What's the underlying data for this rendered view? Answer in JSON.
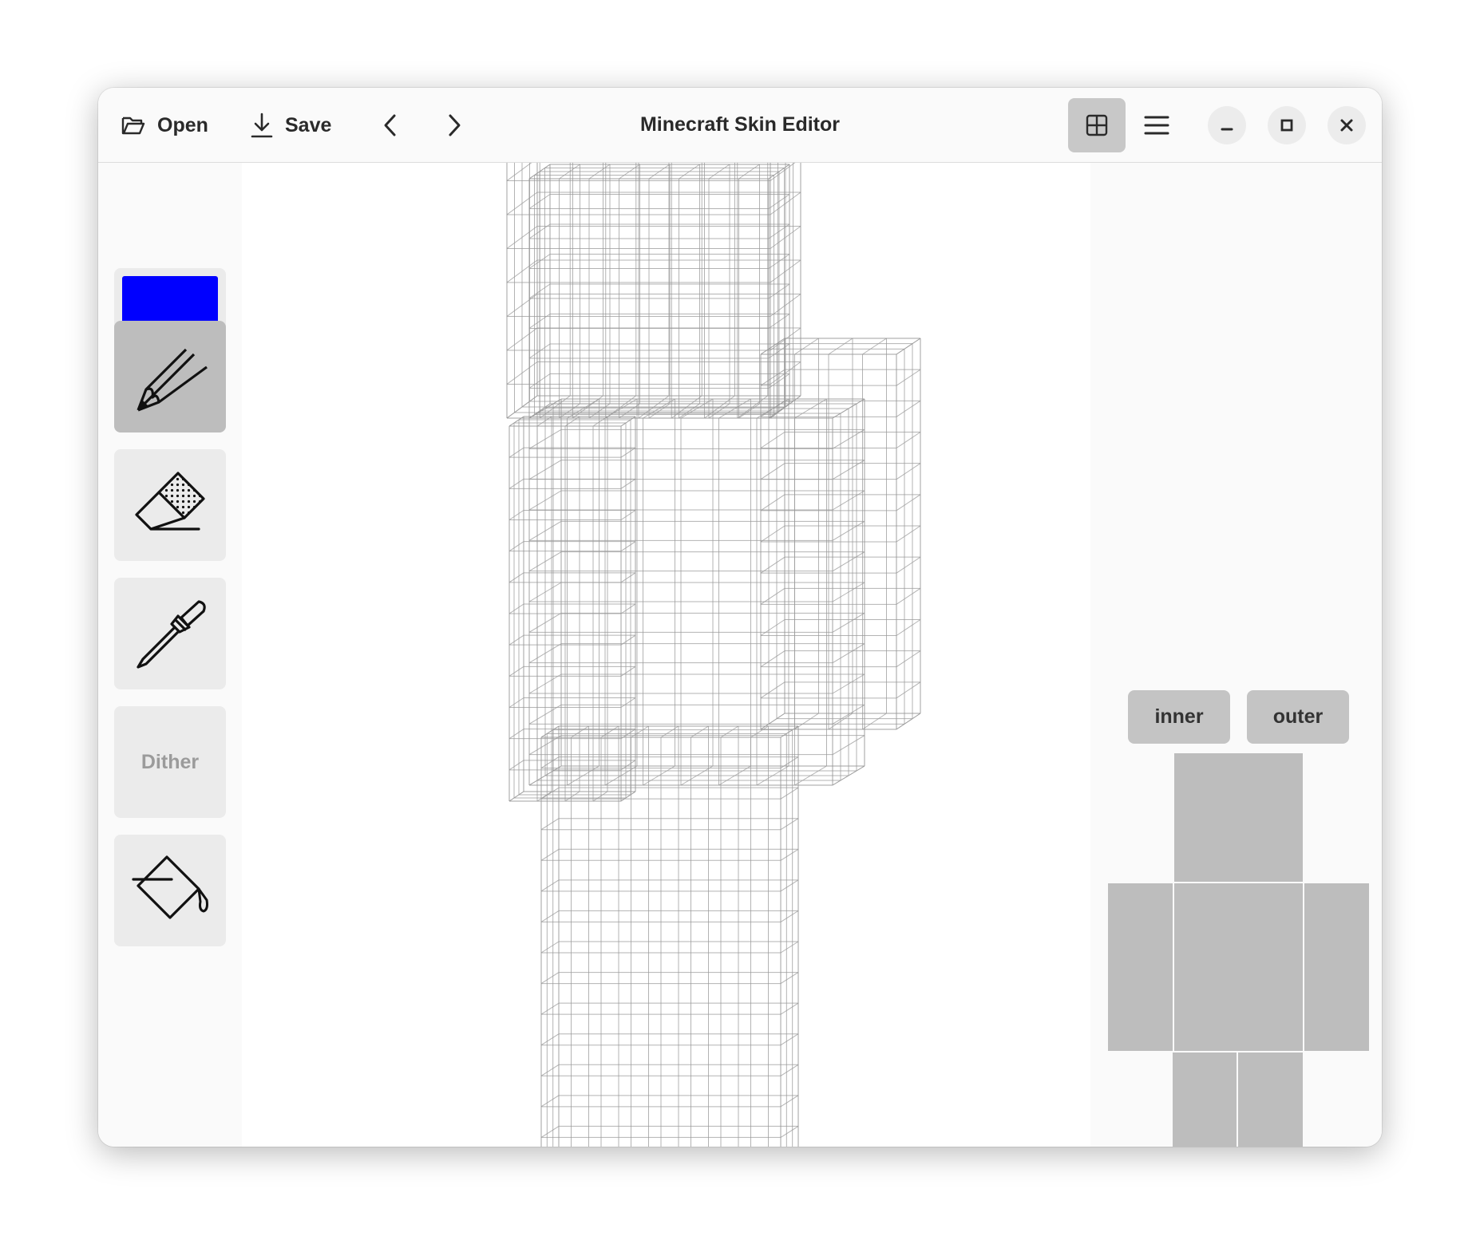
{
  "window": {
    "title": "Minecraft Skin Editor"
  },
  "header": {
    "open_label": "Open",
    "save_label": "Save",
    "icons": [
      "folder-open-icon",
      "download-icon",
      "chevron-left-icon",
      "chevron-right-icon",
      "grid-view-icon",
      "hamburger-menu-icon",
      "minimize-icon",
      "maximize-icon",
      "close-icon"
    ]
  },
  "tools": {
    "current_color": "#0000ff",
    "active": "pencil",
    "items": [
      "color",
      "pencil",
      "eraser",
      "eyedropper",
      "dither",
      "fill"
    ],
    "dither_label": "Dither"
  },
  "layers": {
    "inner_label": "inner",
    "outer_label": "outer"
  },
  "body_parts": [
    "head",
    "right-arm",
    "torso",
    "left-arm",
    "right-leg",
    "left-leg"
  ],
  "colors": {
    "active_tool": "#bdbdbd",
    "tool_bg": "#ebebeb",
    "part": "#bdbdbd",
    "wire": "#9a9a9a"
  }
}
